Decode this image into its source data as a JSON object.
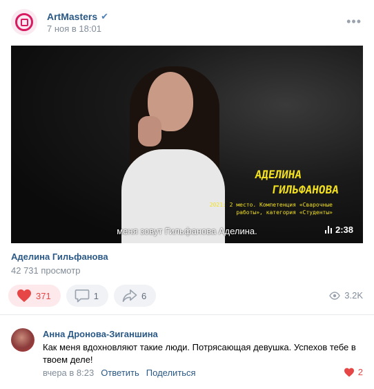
{
  "post": {
    "author": "ArtMasters",
    "date": "7 ноя в 18:01",
    "more_icon": "more-horizontal-icon"
  },
  "video": {
    "overlay_name_line1": "АДЕЛИНА",
    "overlay_name_line2": "ГИЛЬФАНОВА",
    "overlay_caption": "2021: 2 место. Компетенция «Сварочные работы», категория «Студенты»",
    "subtitle": "меня зовут Гильфанова Аделина.",
    "duration": "2:38",
    "title": "Аделина Гильфанова",
    "views": "42 731 просмотр"
  },
  "actions": {
    "likes": "371",
    "comments": "1",
    "shares": "6",
    "view_count": "3.2K"
  },
  "comment": {
    "author": "Анна Дронова-Зиганшина",
    "text": "Как меня вдохновляют такие люди. Потрясающая девушка. Успехов тебе в твоем деле!",
    "time": "вчера в 8:23",
    "reply_label": "Ответить",
    "share_label": "Поделиться",
    "likes": "2"
  },
  "colors": {
    "accent": "#2a5885",
    "like_red": "#e64646",
    "muted": "#818c99",
    "overlay_yellow": "#f2e01f"
  }
}
